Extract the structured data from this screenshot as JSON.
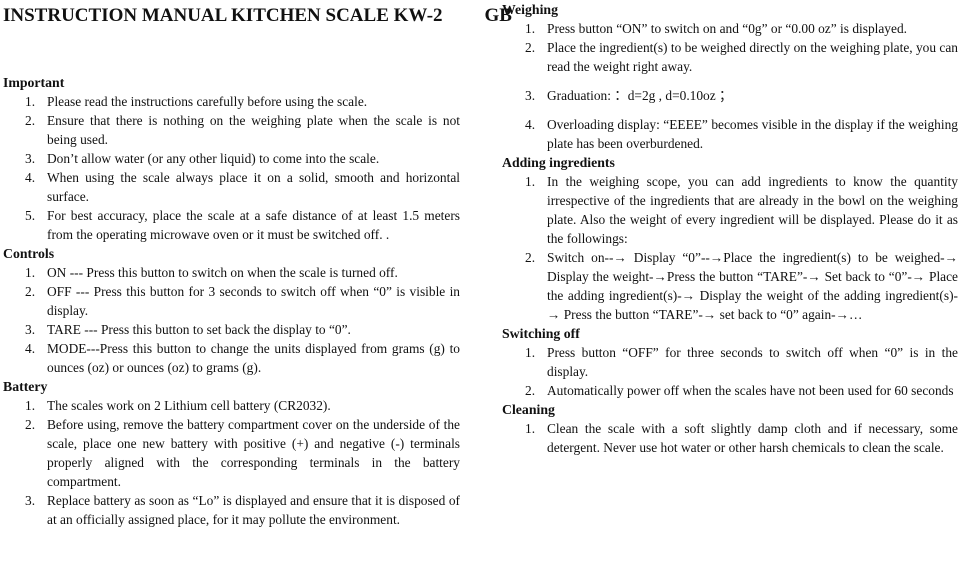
{
  "document": {
    "title": "INSTRUCTION MANUAL KITCHEN SCALE KW-2",
    "language_code": "GB"
  },
  "sections": {
    "important": {
      "heading": "Important",
      "items": [
        {
          "num": "1.",
          "text": "Please read the instructions carefully before using the scale."
        },
        {
          "num": "2.",
          "text": "Ensure that there is nothing on the weighing plate when the scale is not being used."
        },
        {
          "num": "3.",
          "text": "Don’t allow water (or any other liquid) to come into the scale."
        },
        {
          "num": "4.",
          "text": "When using the scale always place it on a solid, smooth and horizontal surface."
        },
        {
          "num": "5.",
          "text": "For best accuracy, place the scale at a safe distance of at least 1.5 meters from the operating microwave oven or it must be switched off.            ."
        }
      ]
    },
    "controls": {
      "heading": "Controls",
      "items": [
        {
          "num": "1.",
          "text": "ON --- Press this button to switch on when the scale is turned off."
        },
        {
          "num": "2.",
          "text": "OFF --- Press this button for 3 seconds to switch off when “0” is visible in display."
        },
        {
          "num": "3.",
          "text": "TARE --- Press this button to set back the display to “0”."
        },
        {
          "num": "4.",
          "text": "MODE---Press this button to change the units displayed from grams (g) to ounces (oz) or ounces (oz) to grams (g)."
        }
      ]
    },
    "battery": {
      "heading": "Battery",
      "items": [
        {
          "num": "1.",
          "text": "The scales work on 2 Lithium cell battery (CR2032)."
        },
        {
          "num": "2.",
          "text": "Before using, remove the battery compartment cover on the underside of the scale, place one new battery with positive (+) and negative (-) terminals properly aligned with the corresponding terminals in the battery compartment."
        },
        {
          "num": "3.",
          "text": "Replace battery as soon as “Lo” is displayed and ensure that it is disposed of at an officially assigned place, for it may pollute the environment."
        }
      ]
    },
    "weighing": {
      "heading": "Weighing",
      "items": [
        {
          "num": "1.",
          "text": "Press button “ON” to switch on and “0g” or “0.00 oz” is displayed."
        },
        {
          "num": "2.",
          "text": "Place the ingredient(s) to be weighed directly on the weighing plate, you can read the weight right away."
        },
        {
          "num": "3.",
          "text": "Graduation: ：d=2g , d=0.10oz ；"
        },
        {
          "num": "4.",
          "text": "Overloading display: “EEEE” becomes visible in the display if the weighing plate has been overburdened."
        }
      ]
    },
    "adding_ingredients": {
      "heading": "Adding ingredients",
      "items": [
        {
          "num": "1.",
          "text": "In the weighing scope, you can add ingredients to know the quantity irrespective of the ingredients that are already in the bowl on the weighing plate. Also the weight of every ingredient will be displayed. Please do it as the followings:"
        },
        {
          "num": "2.",
          "text": "Switch on--→ Display “0”--→Place the ingredient(s) to be weighed-→ Display the weight-→Press the button “TARE”-→ Set back to “0”-→ Place the adding ingredient(s)-→ Display the weight of the adding ingredient(s)-→ Press the button “TARE”-→ set back to “0” again-→…"
        }
      ]
    },
    "switching_off": {
      "heading": "Switching off",
      "items": [
        {
          "num": "1.",
          "text": "Press button “OFF” for three seconds to switch off when “0” is in the display."
        },
        {
          "num": "2.",
          "text": "Automatically power off when the scales have not been used for 60 seconds"
        }
      ]
    },
    "cleaning": {
      "heading": "Cleaning",
      "items": [
        {
          "num": "1.",
          "text": "Clean the scale with a soft slightly damp cloth and if necessary, some detergent. Never use hot water or other harsh chemicals to clean the scale."
        }
      ]
    }
  }
}
